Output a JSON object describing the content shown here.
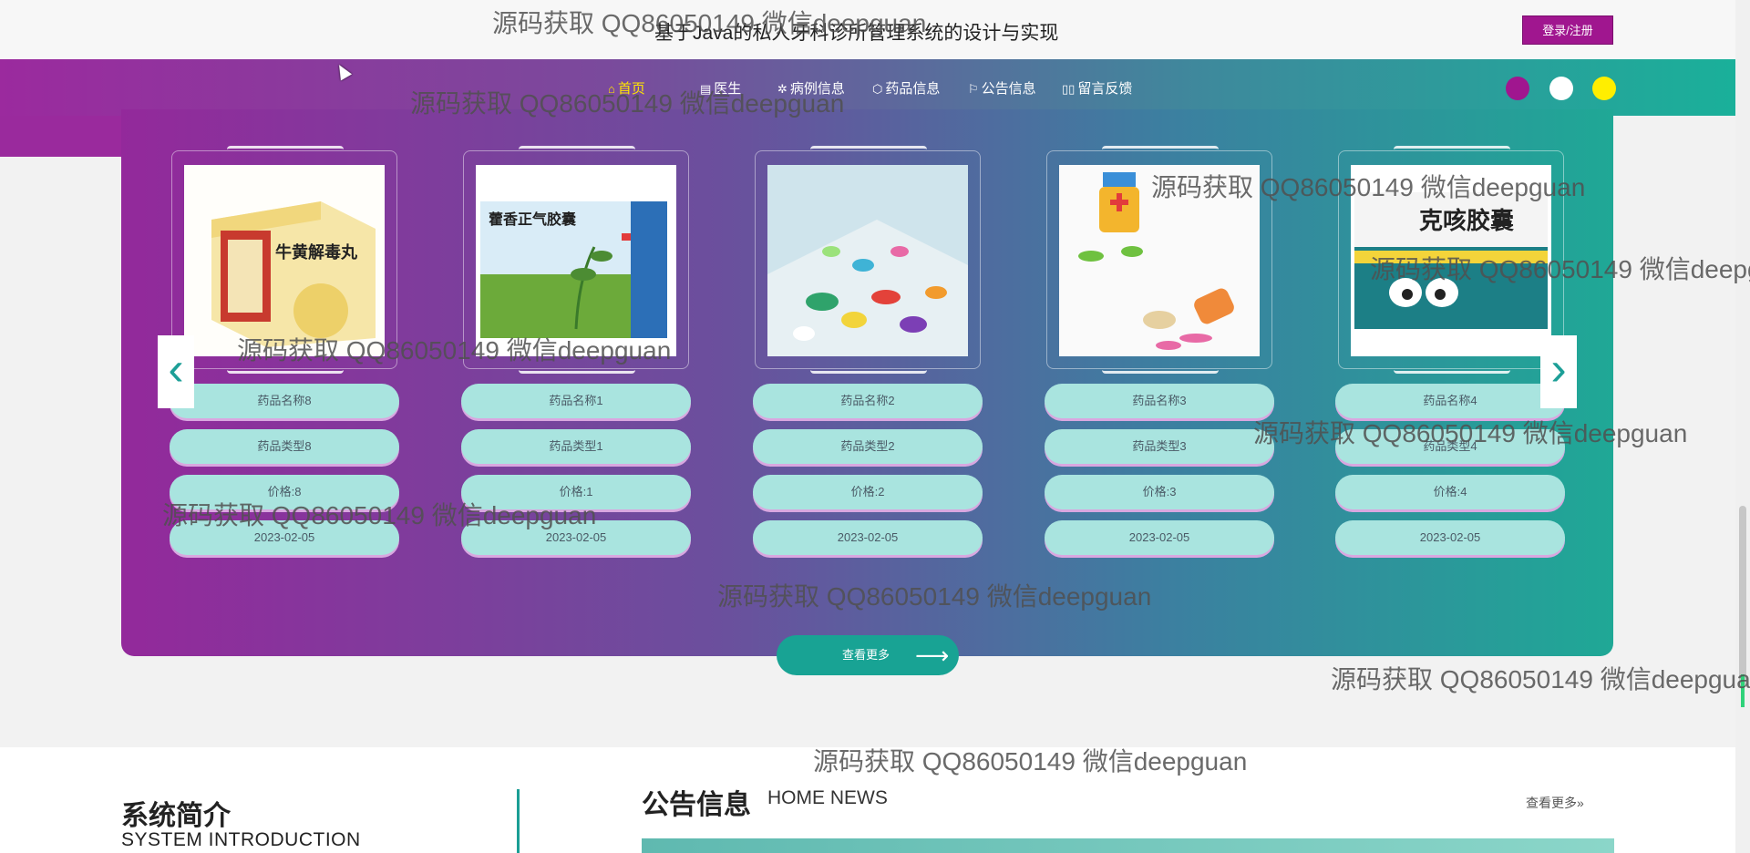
{
  "header": {
    "site_title": "基于Java的私人牙科诊所管理系统的设计与实现",
    "login_label": "登录/注册"
  },
  "nav": {
    "items": [
      {
        "label": "首页",
        "icon": "home-icon",
        "glyph": "⌂"
      },
      {
        "label": "医生",
        "icon": "doctor-icon",
        "glyph": "▤"
      },
      {
        "label": "病例信息",
        "icon": "case-icon",
        "glyph": "✲"
      },
      {
        "label": "药品信息",
        "icon": "cube-icon",
        "glyph": "⬡"
      },
      {
        "label": "公告信息",
        "icon": "flag-icon",
        "glyph": "⚐"
      },
      {
        "label": "留言反馈",
        "icon": "message-icon",
        "glyph": "▯▯"
      }
    ],
    "theme_dots": [
      "#a0168f",
      "#ffffff",
      "#ffee00"
    ]
  },
  "products": [
    {
      "name": "药品名称8",
      "type": "药品类型8",
      "price": "价格:8",
      "date": "2023-02-05"
    },
    {
      "name": "药品名称1",
      "type": "药品类型1",
      "price": "价格:1",
      "date": "2023-02-05"
    },
    {
      "name": "药品名称2",
      "type": "药品类型2",
      "price": "价格:2",
      "date": "2023-02-05"
    },
    {
      "name": "药品名称3",
      "type": "药品类型3",
      "price": "价格:3",
      "date": "2023-02-05"
    },
    {
      "name": "药品名称4",
      "type": "药品类型4",
      "price": "价格:4",
      "date": "2023-02-05"
    }
  ],
  "product_images": {
    "box1_text": "牛黄解毒丸",
    "box2_text": "藿香正气胶囊",
    "box5_text": "克咳胶囊"
  },
  "more_label": "查看更多",
  "intro": {
    "title": "系统简介",
    "subtitle": "SYSTEM INTRODUCTION"
  },
  "news": {
    "title": "公告信息",
    "subtitle": "HOME NEWS",
    "more": "查看更多"
  },
  "watermark": "源码获取 QQ86050149 微信deepguan",
  "colors": {
    "accent_purple": "#a0168f",
    "accent_teal": "#18a394",
    "pill": "#a9e4df"
  }
}
